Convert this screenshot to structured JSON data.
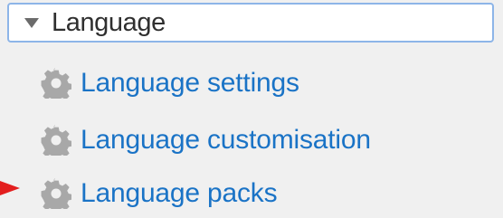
{
  "menu": {
    "title": "Language",
    "items": [
      {
        "label": "Language settings",
        "icon": "gear-icon"
      },
      {
        "label": "Language customisation",
        "icon": "gear-icon"
      },
      {
        "label": "Language packs",
        "icon": "gear-icon"
      }
    ]
  },
  "colors": {
    "header_border": "#8db5e8",
    "link": "#1a73c6",
    "icon": "#a8a8a8",
    "pointer_arrow": "#e31e1e"
  }
}
